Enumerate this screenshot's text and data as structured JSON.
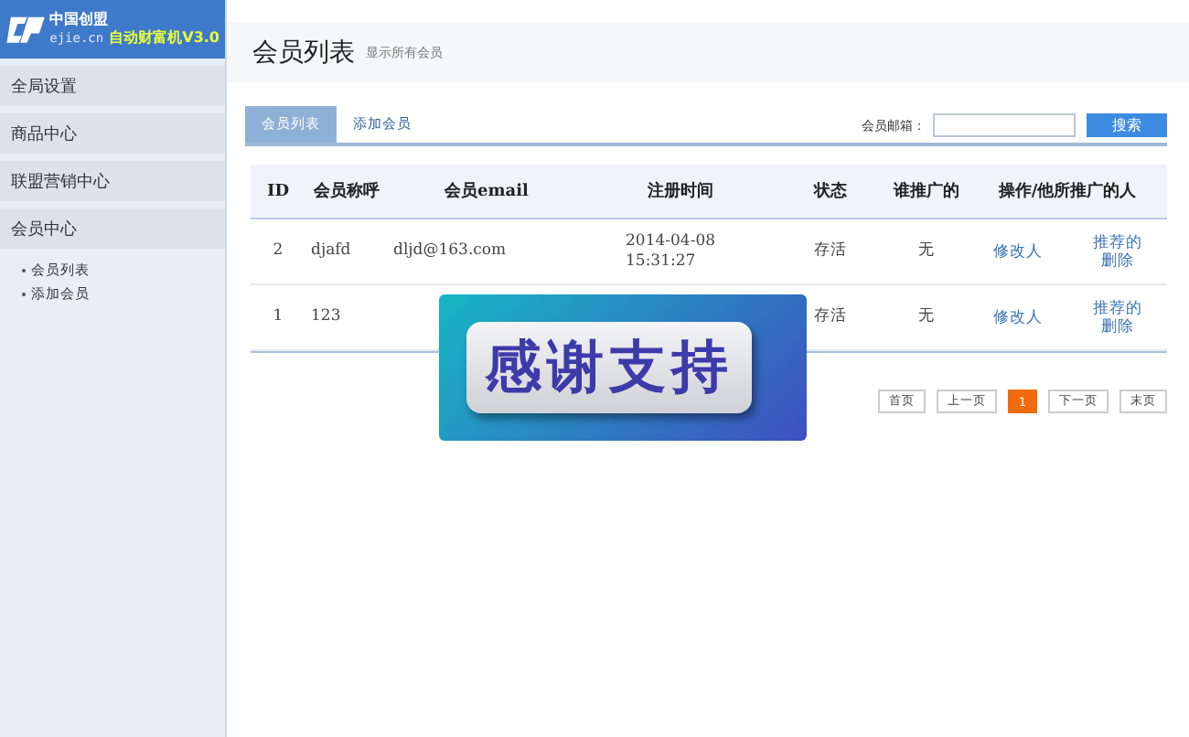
{
  "logo": {
    "brand": "中国创盟",
    "domain": "ejie.cn",
    "product": "自动财富机V3.0"
  },
  "sidebar": {
    "items": [
      {
        "label": "全局设置"
      },
      {
        "label": "商品中心"
      },
      {
        "label": "联盟营销中心"
      },
      {
        "label": "会员中心",
        "children": [
          {
            "label": "会员列表"
          },
          {
            "label": "添加会员"
          }
        ]
      }
    ]
  },
  "header": {
    "title": "会员列表",
    "subtitle": "显示所有会员"
  },
  "tabs": [
    {
      "label": "会员列表",
      "selected": true
    },
    {
      "label": "添加会员",
      "selected": false
    }
  ],
  "search": {
    "label": "会员邮箱：",
    "button": "搜索"
  },
  "table": {
    "columns": [
      "ID",
      "会员称呼",
      "会员email",
      "注册时间",
      "状态",
      "谁推广的",
      "操作/他所推广的人"
    ],
    "rows": [
      {
        "id": "2",
        "name": "djafd",
        "email": "dljd@163.com",
        "time": "2014-04-08 15:31:27",
        "status": "存活",
        "referrer": "无",
        "edit": "修改人",
        "referrals": "推荐的删除"
      },
      {
        "id": "1",
        "name": "123",
        "email": "",
        "time": "",
        "status": "存活",
        "referrer": "无",
        "edit": "修改人",
        "referrals": "推荐的删除"
      }
    ]
  },
  "pagination": [
    {
      "label": "首页",
      "selected": false
    },
    {
      "label": "上一页",
      "selected": false
    },
    {
      "label": "1",
      "selected": true
    },
    {
      "label": "下一页",
      "selected": false
    },
    {
      "label": "末页",
      "selected": false
    }
  ],
  "banner": {
    "text": "感谢支持"
  }
}
